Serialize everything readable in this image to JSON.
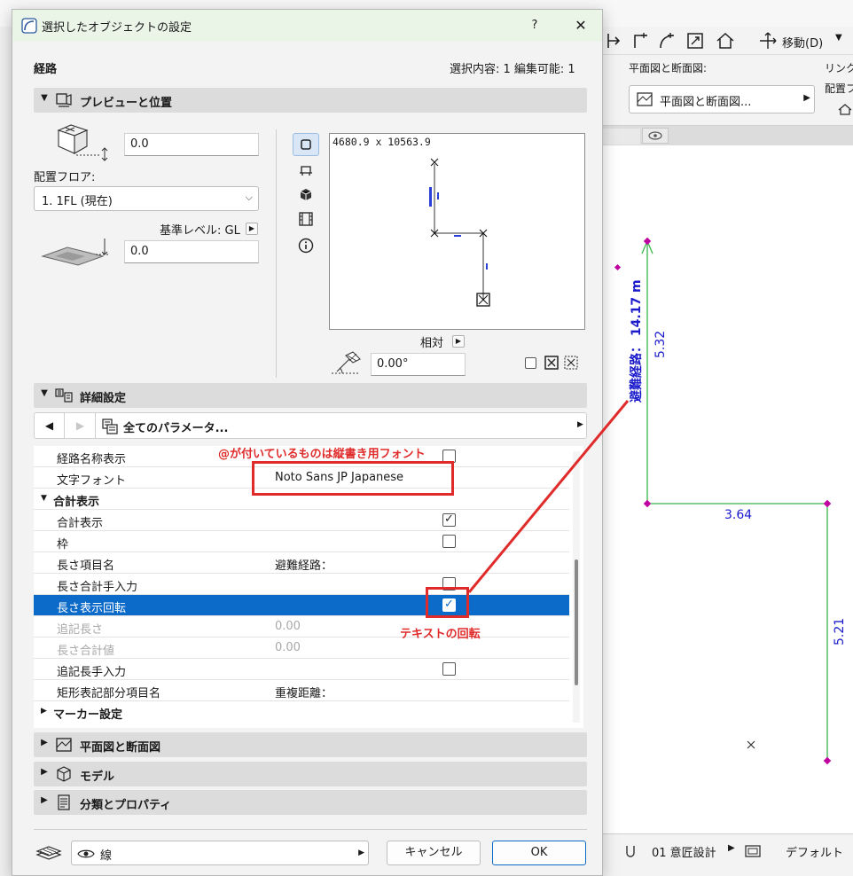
{
  "background": {
    "toolbar": {
      "move_label": "移動(D)"
    },
    "panel": {
      "floor_section_title": "平面図と断面図:",
      "floor_section_button": "平面図と断面図...",
      "link_title": "リンクフ",
      "placement_title": "配置フ"
    },
    "canvas": {
      "route_label": "避難経路： 14.17 m",
      "dim_vertical_1": "5.32",
      "dim_horizontal": "3.64",
      "dim_vertical_2": "5.21"
    },
    "statusbar": {
      "design_layer": "01 意匠設計",
      "default_label": "デフォルト"
    }
  },
  "dialog": {
    "title": "選択したオブジェクトの設定",
    "help_label": "?",
    "close_label": "✕",
    "object_type": "経路",
    "selection_info": "選択内容: 1 編集可能: 1",
    "sections": {
      "preview": "プレビューと位置",
      "details": "詳細設定",
      "floor_section": "平面図と断面図",
      "model": "モデル",
      "classification": "分類とプロパティ"
    },
    "top_offset": "0.0",
    "home_floor_label": "配置フロア:",
    "home_floor_value": "1. 1FL (現在)",
    "ref_level_label": "基準レベル: GL",
    "bottom_offset": "0.0",
    "preview_size": "4680.9 x 10563.9",
    "relative_label": "相対",
    "rotation_angle": "0.00°",
    "param_nav_label": "全てのパラメータ...",
    "parameters": [
      {
        "name": "経路名称表示",
        "value": "",
        "checkbox": false
      },
      {
        "name": "文字フォント",
        "value": "Noto Sans JP Japanese"
      },
      {
        "name": "合計表示",
        "group": true
      },
      {
        "name": "合計表示",
        "checkbox": true
      },
      {
        "name": "枠",
        "checkbox": false
      },
      {
        "name": "長さ項目名",
        "value": "避難経路："
      },
      {
        "name": "長さ合計手入力",
        "checkbox": false
      },
      {
        "name": "長さ表示回転",
        "checkbox": true,
        "selected": true
      },
      {
        "name": "追記長さ",
        "value": "0.00",
        "disabled": true
      },
      {
        "name": "長さ合計値",
        "value": "0.00",
        "disabled": true
      },
      {
        "name": "追記長手入力",
        "checkbox": false
      },
      {
        "name": "矩形表記部分項目名",
        "value": "重複距離："
      },
      {
        "name": "マーカー設定",
        "group": true,
        "collapsed": true
      }
    ],
    "footer": {
      "layer_value": "線",
      "cancel_label": "キャンセル",
      "ok_label": "OK"
    }
  },
  "annotations": {
    "font_note": "@が付いているものは縦書き用フォント",
    "rotate_note": "テキストの回転"
  },
  "colors": {
    "selection_blue": "#0c6ac9",
    "annotation_red": "#e02b2b",
    "route_green": "#39b54a",
    "node_magenta": "#c000a0",
    "dim_blue": "#1a1acc"
  }
}
